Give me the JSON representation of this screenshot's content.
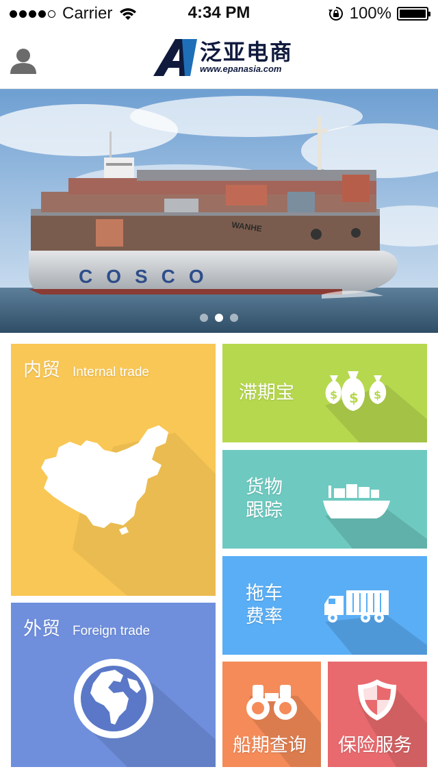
{
  "status_bar": {
    "carrier": "Carrier",
    "time": "4:34 PM",
    "battery": "100%",
    "icons": [
      "signal-dots-icon",
      "wifi-icon",
      "rotation-lock-icon",
      "battery-icon"
    ]
  },
  "header": {
    "profile_icon": "user-avatar-icon",
    "logo_name": "泛亚电商",
    "logo_url": "www.epanasia.com"
  },
  "banner": {
    "slide_count": 3,
    "active_slide": 2,
    "ship_hull_text": "COSCO",
    "ship_bow_text": "WANHE"
  },
  "tiles": {
    "domestic": {
      "label_cn": "内贸",
      "label_en": "Internal trade",
      "icon": "china-map-icon",
      "color": "#f9c755"
    },
    "foreign": {
      "label_cn": "外贸",
      "label_en": "Foreign trade",
      "icon": "globe-icon",
      "color": "#6f8fdd"
    },
    "demurrage": {
      "label": "滞期宝",
      "icon": "money-bags-icon",
      "color": "#b6d84e"
    },
    "tracking": {
      "line1": "货物",
      "line2": "跟踪",
      "icon": "cargo-ship-icon",
      "color": "#6ecac1"
    },
    "trailer": {
      "line1": "拖车",
      "line2": "费率",
      "icon": "truck-icon",
      "color": "#5aaef5"
    },
    "schedule": {
      "label": "船期查询",
      "icon": "binoculars-icon",
      "color": "#f48b58"
    },
    "insurance": {
      "label": "保险服务",
      "icon": "shield-icon",
      "color": "#e86a6e"
    }
  }
}
